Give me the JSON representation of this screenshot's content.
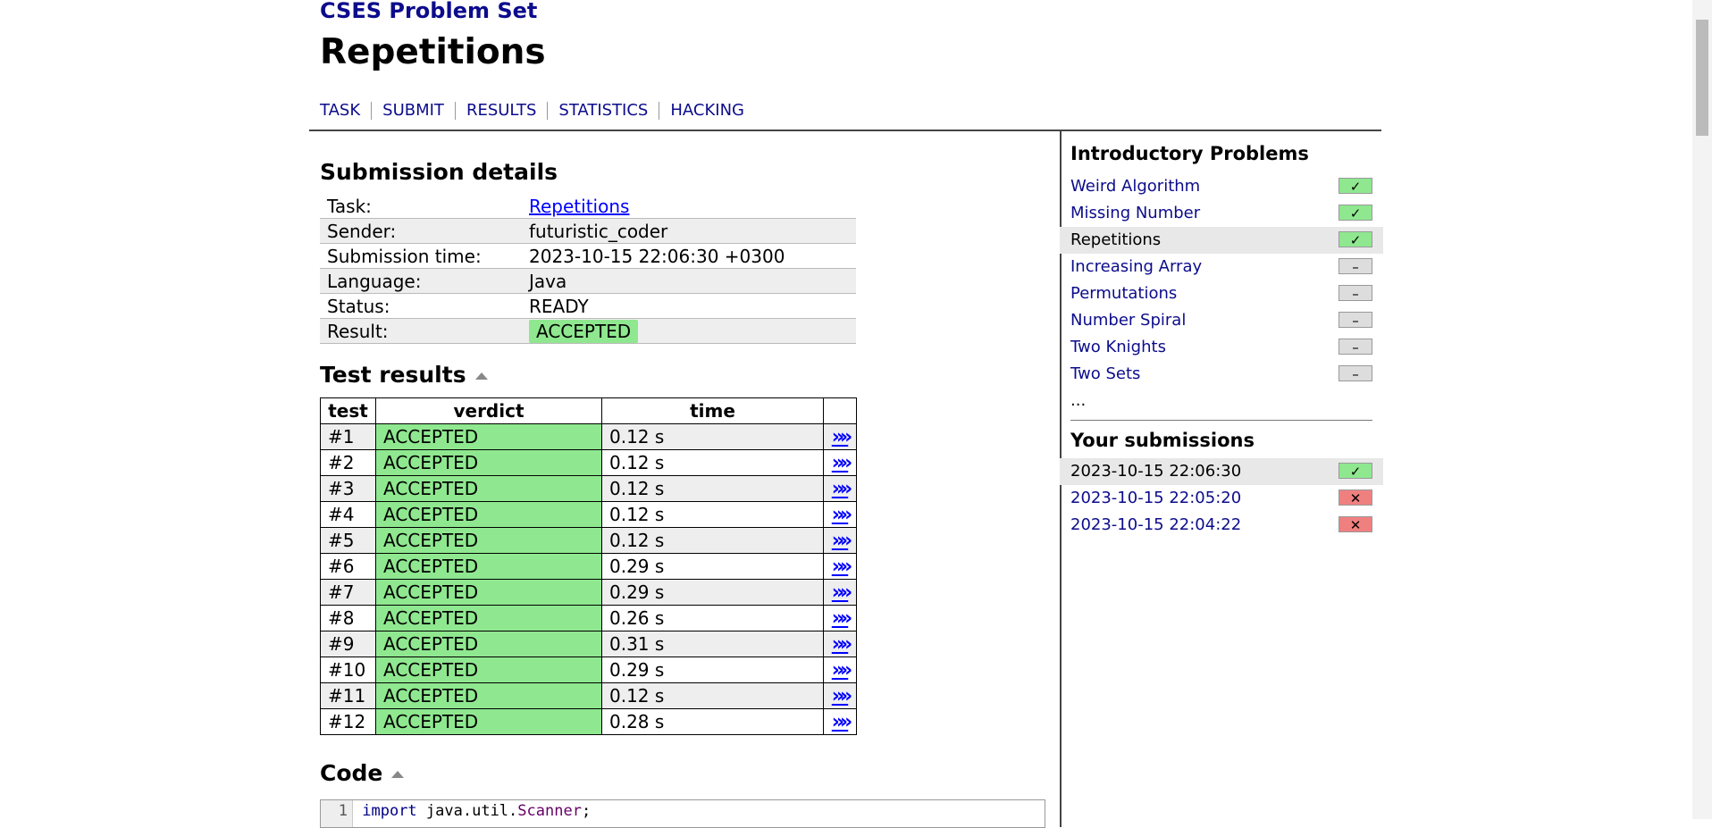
{
  "site_title": "CSES Problem Set",
  "page_title": "Repetitions",
  "nav": [
    "TASK",
    "SUBMIT",
    "RESULTS",
    "STATISTICS",
    "HACKING"
  ],
  "details": {
    "heading": "Submission details",
    "task_label": "Task:",
    "task_value": "Repetitions",
    "sender_label": "Sender:",
    "sender_value": "futuristic_coder",
    "time_label": "Submission time:",
    "time_value": "2023-10-15 22:06:30 +0300",
    "language_label": "Language:",
    "language_value": "Java",
    "status_label": "Status:",
    "status_value": "READY",
    "result_label": "Result:",
    "result_value": "ACCEPTED"
  },
  "tests": {
    "heading": "Test results",
    "headers": [
      "test",
      "verdict",
      "time"
    ],
    "rows": [
      {
        "id": "#1",
        "verdict": "ACCEPTED",
        "time": "0.12 s"
      },
      {
        "id": "#2",
        "verdict": "ACCEPTED",
        "time": "0.12 s"
      },
      {
        "id": "#3",
        "verdict": "ACCEPTED",
        "time": "0.12 s"
      },
      {
        "id": "#4",
        "verdict": "ACCEPTED",
        "time": "0.12 s"
      },
      {
        "id": "#5",
        "verdict": "ACCEPTED",
        "time": "0.12 s"
      },
      {
        "id": "#6",
        "verdict": "ACCEPTED",
        "time": "0.29 s"
      },
      {
        "id": "#7",
        "verdict": "ACCEPTED",
        "time": "0.29 s"
      },
      {
        "id": "#8",
        "verdict": "ACCEPTED",
        "time": "0.26 s"
      },
      {
        "id": "#9",
        "verdict": "ACCEPTED",
        "time": "0.31 s"
      },
      {
        "id": "#10",
        "verdict": "ACCEPTED",
        "time": "0.29 s"
      },
      {
        "id": "#11",
        "verdict": "ACCEPTED",
        "time": "0.12 s"
      },
      {
        "id": "#12",
        "verdict": "ACCEPTED",
        "time": "0.28 s"
      }
    ],
    "link_glyph": "»"
  },
  "code": {
    "heading": "Code",
    "line_no": "1",
    "kw": "import",
    "pkg": "java.util.",
    "cls": "Scanner",
    "end": ";"
  },
  "sidebar": {
    "problems_heading": "Introductory Problems",
    "problems": [
      {
        "name": "Weird Algorithm",
        "status": "ok"
      },
      {
        "name": "Missing Number",
        "status": "ok"
      },
      {
        "name": "Repetitions",
        "status": "ok",
        "current": true
      },
      {
        "name": "Increasing Array",
        "status": "none"
      },
      {
        "name": "Permutations",
        "status": "none"
      },
      {
        "name": "Number Spiral",
        "status": "none"
      },
      {
        "name": "Two Knights",
        "status": "none"
      },
      {
        "name": "Two Sets",
        "status": "none"
      }
    ],
    "more": "...",
    "submissions_heading": "Your submissions",
    "submissions": [
      {
        "time": "2023-10-15 22:06:30",
        "status": "ok",
        "current": true
      },
      {
        "time": "2023-10-15 22:05:20",
        "status": "fail"
      },
      {
        "time": "2023-10-15 22:04:22",
        "status": "fail"
      }
    ],
    "glyphs": {
      "ok": "✓",
      "none": "–",
      "fail": "✕"
    }
  },
  "colors": {
    "link": "#0c0c8c",
    "accepted": "#8fe88f",
    "failed": "#f08080"
  }
}
